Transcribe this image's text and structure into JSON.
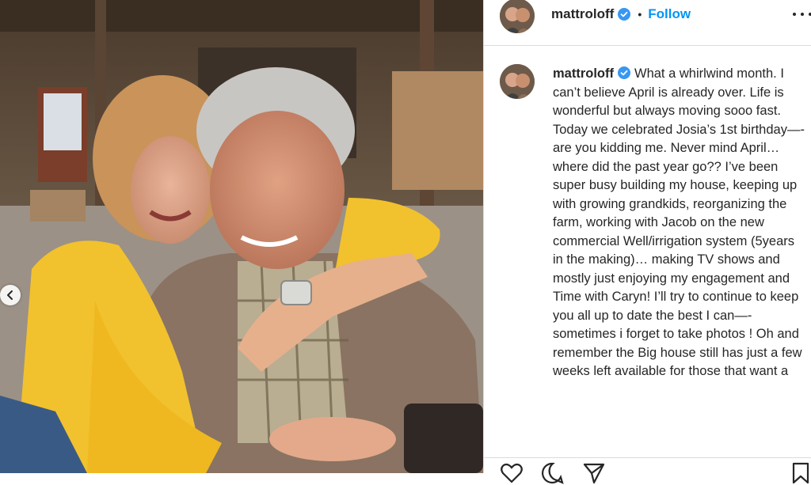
{
  "post": {
    "username": "mattroloff",
    "separator": "•",
    "follow_label": "Follow",
    "caption": "What a whirlwind month. I can’t believe April is already over. Life is wonderful but always moving sooo fast. Today we celebrated Josia’s 1st birthday—- are you kidding me. Never mind April… where did the past year go?? I’ve been super busy building my house, keeping up with growing grandkids, reorganizing the farm, working with Jacob on the new commercial Well/irrigation system (5years in the making)… making TV shows and mostly just enjoying my engagement and Time with Caryn! I’ll try to continue to keep you all up to date the best I can—- sometimes i forget to take photos ! Oh and remember the Big house still has just a few weeks left available for those that want a"
  },
  "icons": {
    "prev": "chevron-left-icon",
    "verified": "verified-badge-icon",
    "more": "more-options-icon",
    "like": "heart-icon",
    "comment": "comment-icon",
    "share": "share-icon",
    "save": "bookmark-icon"
  },
  "colors": {
    "accent": "#0095f6",
    "text": "#262626",
    "border": "#dbdbdb"
  }
}
